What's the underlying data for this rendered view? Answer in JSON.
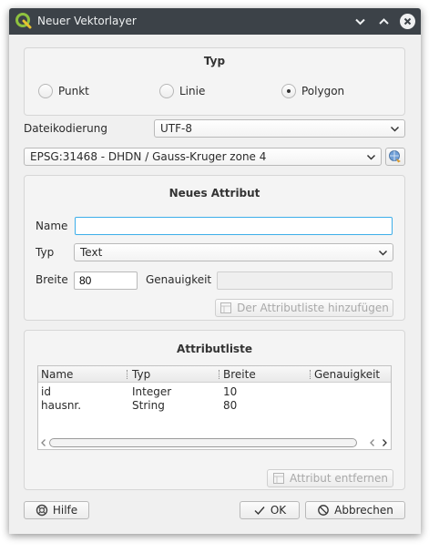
{
  "window": {
    "title": "Neuer Vektorlayer"
  },
  "type_group": {
    "title": "Typ",
    "options": [
      {
        "label": "Punkt",
        "checked": false
      },
      {
        "label": "Linie",
        "checked": false
      },
      {
        "label": "Polygon",
        "checked": true
      }
    ]
  },
  "encoding": {
    "label": "Dateikodierung",
    "value": "UTF-8"
  },
  "crs": {
    "value": "EPSG:31468 - DHDN / Gauss-Kruger zone 4"
  },
  "new_attribute": {
    "title": "Neues Attribut",
    "name_label": "Name",
    "name_value": "",
    "type_label": "Typ",
    "type_value": "Text",
    "width_label": "Breite",
    "width_value": "80",
    "precision_label": "Genauigkeit",
    "precision_value": "",
    "add_button": "Der Attributliste hinzufügen"
  },
  "attribute_list": {
    "title": "Attributliste",
    "columns": [
      "Name",
      "Typ",
      "Breite",
      "Genauigkeit"
    ],
    "rows": [
      [
        "id",
        "Integer",
        "10",
        ""
      ],
      [
        "hausnr.",
        "String",
        "80",
        ""
      ]
    ],
    "remove_button": "Attribut entfernen"
  },
  "footer": {
    "help": "Hilfe",
    "ok": "OK",
    "cancel": "Abbrechen"
  },
  "colors": {
    "titlebar": "#3c4248",
    "focus": "#3daee9",
    "window_bg": "#f0f0f0"
  }
}
